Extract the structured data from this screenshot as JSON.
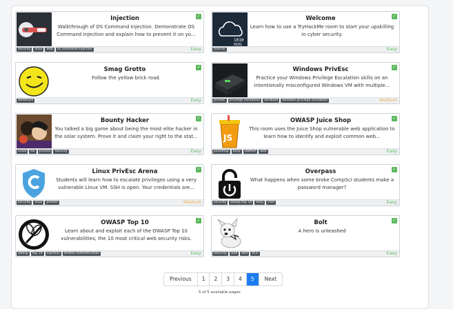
{
  "rooms": [
    {
      "title": "Injection",
      "desc": "Walkthrough of OS Command Injection. Demonstrate OS Command Injection and explain how to prevent it on yo...",
      "tags": [
        "security",
        "linux",
        "web",
        "os command injection"
      ],
      "difficulty": "Easy",
      "icon": "injection-room-icon"
    },
    {
      "title": "Welcome",
      "desc": "Learn how to use a TryHackMe room to start your upskilling in cyber security.",
      "tags": [
        "tutorial"
      ],
      "difficulty": "Easy",
      "icon": "cloud-binary-icon"
    },
    {
      "title": "Smag Grotto",
      "desc": "Follow the yellow brick road.",
      "tags": [
        "wireshark"
      ],
      "difficulty": "Easy",
      "icon": "smiley-face-icon"
    },
    {
      "title": "Windows PrivEsc",
      "desc": "Practice your Windows Privilege Escalation skills on an intentionally misconfigured Windows VM with multiple...",
      "tags": [
        "privesc",
        "privilege escalation",
        "windows",
        "windows privilege escalation"
      ],
      "difficulty": "Medium",
      "icon": "server-box-icon"
    },
    {
      "title": "Bounty Hacker",
      "desc": "You talked a big game about being the most elite hacker in the solar system. Prove it and claim your right to the stat...",
      "tags": [
        "Linux",
        "tar",
        "privesc",
        "security"
      ],
      "difficulty": "Easy",
      "icon": "anime-crew-icon"
    },
    {
      "title": "OWASP Juice Shop",
      "desc": "This room uses the Juice Shop vulnerable web application to learn how to identify and exploit common web...",
      "tags": [
        "juiceshop",
        "burp",
        "OWASP",
        "web"
      ],
      "difficulty": "Easy",
      "icon": "juice-shop-icon"
    },
    {
      "title": "Linux PrivEsc Arena",
      "desc": "Students will learn how to escalate privileges using a very vulnerable Linux VM. SSH is open. Your credentials are...",
      "tags": [
        "security",
        "linux",
        "privesc"
      ],
      "difficulty": "Medium",
      "icon": "shield-c-icon"
    },
    {
      "title": "Overpass",
      "desc": "What happens when some broke CompSci students make a password manager?",
      "tags": [
        "security",
        "owasp top 10",
        "easy",
        "cron"
      ],
      "difficulty": "Easy",
      "icon": "padlock-icon"
    },
    {
      "title": "OWASP Top 10",
      "desc": "Learn about and exploit each of the OWASP Top 10 vulnerabilities; the 10 most critical web security risks.",
      "tags": [
        "owasp",
        "top 10",
        "injection",
        "Broken Authentication"
      ],
      "difficulty": "Easy",
      "icon": "owasp-wasp-icon"
    },
    {
      "title": "Bolt",
      "desc": "A hero is unleashed",
      "tags": [
        "Security",
        "web",
        "Bolt",
        "RCE"
      ],
      "difficulty": "Easy",
      "icon": "white-dog-icon"
    }
  ],
  "pagination": {
    "previous": "Previous",
    "pages": [
      "1",
      "2",
      "3",
      "4",
      "5"
    ],
    "current": "5",
    "next": "Next",
    "info": "5 of 5 available pages"
  },
  "check_glyph": "✓"
}
